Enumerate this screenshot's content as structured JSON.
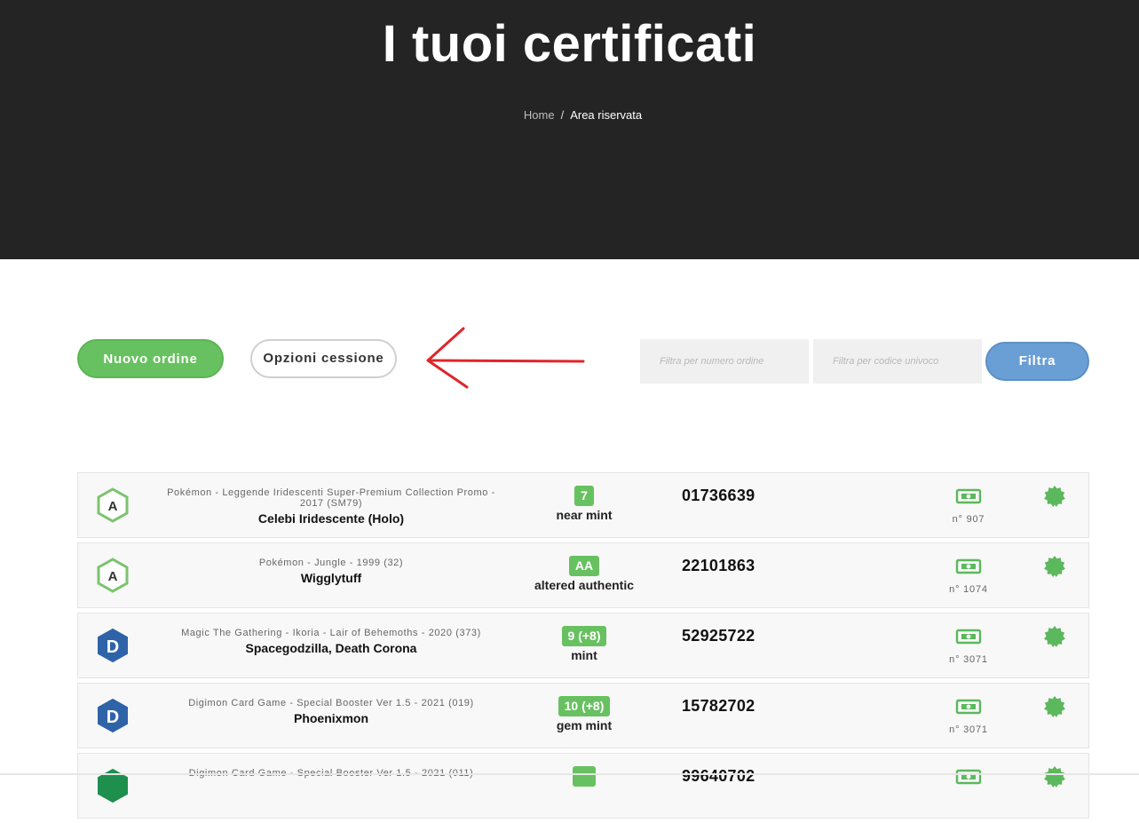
{
  "header": {
    "title": "I tuoi certificati",
    "breadcrumb": {
      "home": "Home",
      "separator": "/",
      "current": "Area riservata"
    }
  },
  "actions": {
    "new_order": "Nuovo ordine",
    "cession_options": "Opzioni cessione"
  },
  "filters": {
    "order_placeholder": "Filtra per numero ordine",
    "code_placeholder": "Filtra per codice univoco",
    "filter_button": "Filtra"
  },
  "colors": {
    "accent_green": "#68c160",
    "accent_blue": "#6a9fd6",
    "hero_bg": "#242424",
    "arrow_red": "#e0252b"
  },
  "certificates": [
    {
      "icon_letter": "A",
      "icon_style": "outline-green",
      "set": "Pokémon - Leggende Iridescenti Super-Premium Collection Promo - 2017 (SM79)",
      "name": "Celebi Iridescente (Holo)",
      "grade": "7",
      "grade_label": "near mint",
      "code": "01736639",
      "number": "n° 907"
    },
    {
      "icon_letter": "A",
      "icon_style": "outline-green",
      "set": "Pokémon - Jungle - 1999 (32)",
      "name": "Wigglytuff",
      "grade": "AA",
      "grade_label": "altered authentic",
      "code": "22101863",
      "number": "n° 1074"
    },
    {
      "icon_letter": "D",
      "icon_style": "solid-blue",
      "set": "Magic The Gathering - Ikoria - Lair of Behemoths - 2020 (373)",
      "name": "Spacegodzilla, Death Corona",
      "grade": "9 (+8)",
      "grade_label": "mint",
      "code": "52925722",
      "number": "n° 3071"
    },
    {
      "icon_letter": "D",
      "icon_style": "solid-blue",
      "set": "Digimon Card Game - Special Booster Ver 1.5 - 2021 (019)",
      "name": "Phoenixmon",
      "grade": "10 (+8)",
      "grade_label": "gem mint",
      "code": "15782702",
      "number": "n° 3071"
    },
    {
      "icon_letter": "",
      "icon_style": "solid-green",
      "set": "Digimon Card Game - Special Booster Ver 1.5 - 2021 (011)",
      "name": "",
      "grade": "",
      "grade_label": "",
      "code": "99640702",
      "number": ""
    }
  ]
}
